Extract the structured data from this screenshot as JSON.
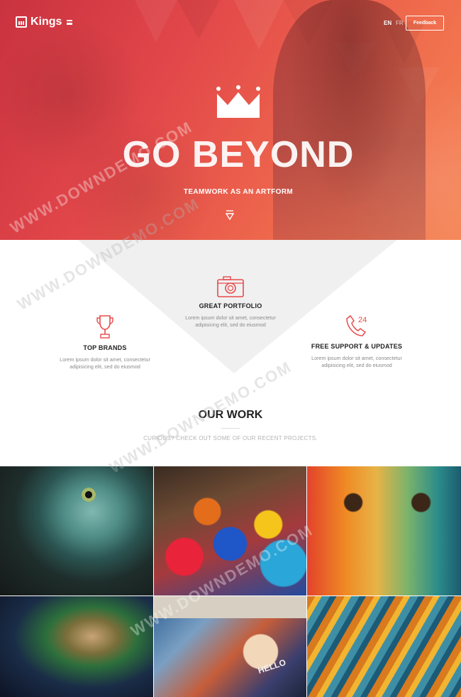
{
  "header": {
    "logo_text": "Kings",
    "lang_en": "EN",
    "lang_fr": "FR",
    "feedback_label": "Feedback"
  },
  "hero": {
    "title": "GO BEYOND",
    "subtitle": "TEAMWORK AS AN ARTFORM"
  },
  "features": [
    {
      "title": "GREAT PORTFOLIO",
      "text_line1": "Lorem ipsum dolor sit amet, consectetur",
      "text_line2": "adipisicing elit, sed do eiusmod",
      "icon": "camera-icon"
    },
    {
      "title": "TOP BRANDS",
      "text_line1": "Lorem ipsum dolor sit amet, consectetur",
      "text_line2": "adipisicing elit, sed do eiusmod",
      "icon": "trophy-icon"
    },
    {
      "title": "FREE SUPPORT & UPDATES",
      "text_line1": "Lorem ipsum dolor sit amet, consectetur",
      "text_line2": "adipisicing elit, sed do eiusmod",
      "icon": "phone-24-icon",
      "icon_badge": "24"
    }
  ],
  "our_work": {
    "title": "OUR WORK",
    "subtitle": "CURIOUS? CHECK OUT SOME OF OUR RECENT PROJECTS."
  },
  "gallery": {
    "sign_text": "HELLO"
  },
  "watermark": {
    "text_1": "WWW.DOWNDEMO.COM",
    "text_2": "WWW.DOWNDEMO.COM",
    "text_3": "WWW.DOWNDEMO.COM",
    "text_4": "WWW.DOWNDEMO.COM"
  },
  "colors": {
    "accent": "#e84a4a",
    "hero_start": "#c9323f",
    "hero_end": "#f58454"
  }
}
